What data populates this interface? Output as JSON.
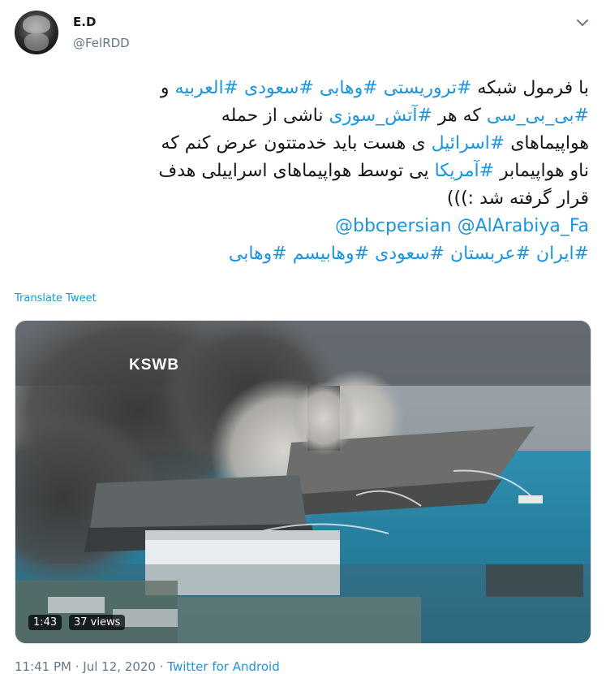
{
  "user": {
    "name": "E.D",
    "handle": "@FelRDD"
  },
  "tweet": {
    "lines": [
      [
        {
          "t": "با فرمول شبکه ",
          "k": "text"
        },
        {
          "t": "#تروریستی",
          "k": "hash"
        },
        {
          "t": " ",
          "k": "text"
        },
        {
          "t": "#وهابی",
          "k": "hash"
        },
        {
          "t": " ",
          "k": "text"
        },
        {
          "t": "#سعودی",
          "k": "hash"
        },
        {
          "t": " ",
          "k": "text"
        },
        {
          "t": "#العربیه",
          "k": "hash"
        },
        {
          "t": " و",
          "k": "text"
        }
      ],
      [
        {
          "t": "#بی_بی_سی",
          "k": "hash"
        },
        {
          "t": " که هر ",
          "k": "text"
        },
        {
          "t": "#آتش_سوزی",
          "k": "hash"
        },
        {
          "t": " ناشی از حمله",
          "k": "text"
        }
      ],
      [
        {
          "t": "هواپیماهای ",
          "k": "text"
        },
        {
          "t": "#اسرائیل",
          "k": "hash"
        },
        {
          "t": " ی هست باید خدمتتون عرض کنم که",
          "k": "text"
        }
      ],
      [
        {
          "t": "ناو هواپیمابر ",
          "k": "text"
        },
        {
          "t": "#آمریکا",
          "k": "hash"
        },
        {
          "t": " یی توسط هواپیماهای اسراییلی هدف",
          "k": "text"
        }
      ],
      [
        {
          "t": "قرار گرفته شد :)))",
          "k": "text"
        }
      ]
    ],
    "mentions": [
      {
        "t": "@bbcpersian",
        "k": "mention"
      },
      {
        "t": " ",
        "k": "text"
      },
      {
        "t": "@AlArabiya_Fa",
        "k": "mention"
      }
    ],
    "hashtag_line": [
      {
        "t": "#ایران",
        "k": "hash"
      },
      {
        "t": " ",
        "k": "text"
      },
      {
        "t": "#عربستان",
        "k": "hash"
      },
      {
        "t": " ",
        "k": "text"
      },
      {
        "t": "#سعودی",
        "k": "hash"
      },
      {
        "t": " ",
        "k": "text"
      },
      {
        "t": "#وهابیسم",
        "k": "hash"
      },
      {
        "t": " ",
        "k": "text"
      },
      {
        "t": "#وهابی",
        "k": "hash"
      }
    ],
    "translate_label": "Translate Tweet"
  },
  "media": {
    "channel_logo": "KSWB",
    "duration": "1:43",
    "views": "37 views"
  },
  "footer": {
    "time": "11:41 PM",
    "sep1": " · ",
    "date": "Jul 12, 2020",
    "sep2": " · ",
    "source": "Twitter for Android"
  },
  "icons": {
    "menu": "chevron-down-icon",
    "avatar": "avatar"
  },
  "colors": {
    "link": "#1b95e0",
    "secondary_text": "#657786",
    "primary_text": "#14171a"
  }
}
